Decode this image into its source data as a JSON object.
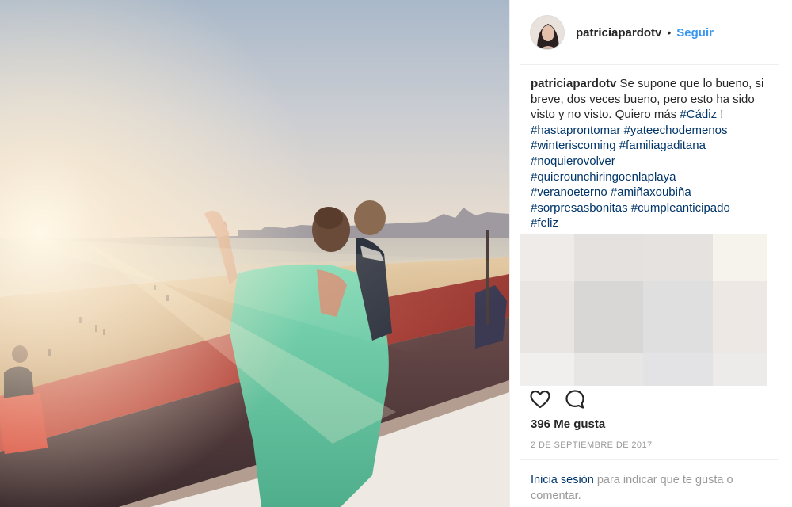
{
  "post": {
    "username": "patriciapardotv",
    "separator": "•",
    "follow_label": "Seguir",
    "caption": {
      "username": "patriciapardotv",
      "text": " Se supone que lo bueno, si breve, dos veces bueno, pero esto ha sido visto y no visto. Quiero más ",
      "hashtags_inline": "#Cádiz",
      "after_inline": " ! ",
      "hashtags": [
        "#hastaprontomar",
        "#yateechodemenos",
        "#winteriscoming",
        "#familiagaditana",
        "#noquierovolver",
        "#quierounchiringoenlaplaya",
        "#veranoeterno",
        "#amiñaxoubiña",
        "#sorpresasbonitas",
        "#cumpleanticipado",
        "#feliz"
      ]
    },
    "blurred_colors": [
      "#eeebe8",
      "#e4e1df",
      "#e6e2df",
      "#f6f3ec",
      "#e8e5e3",
      "#d9d7d6",
      "#e0dfdf",
      "#eee8e4",
      "#f1efed",
      "#e7e6e5",
      "#e3e3e5",
      "#ecebea"
    ],
    "actions": {
      "like_icon": "heart-icon",
      "comment_icon": "comment-icon"
    },
    "likes": "396 Me gusta",
    "date": "2 DE SEPTIEMBRE DE 2017",
    "login_prompt": {
      "link": "Inicia sesión",
      "text": " para indicar que te gusta o comentar."
    }
  }
}
